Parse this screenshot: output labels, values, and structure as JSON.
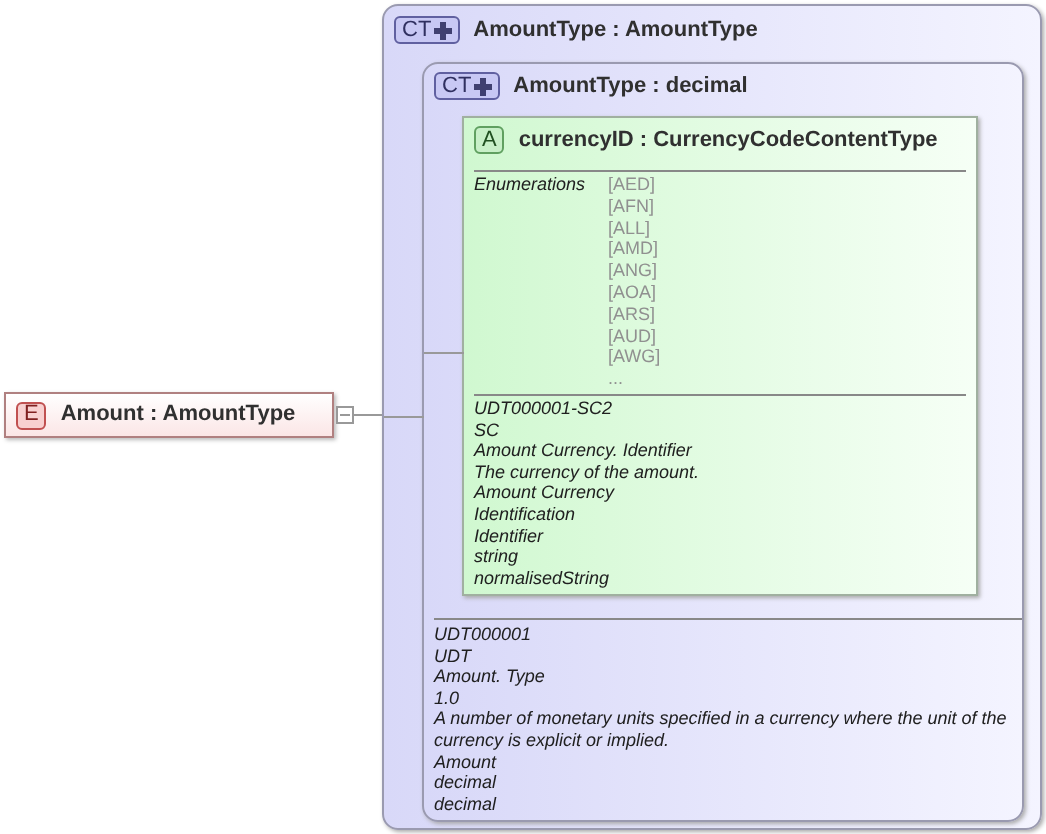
{
  "element": {
    "badge": "E",
    "name": "Amount",
    "type": ": AmountType"
  },
  "complex_type": {
    "badge": "CT",
    "name": "AmountType",
    "type": ": AmountType",
    "base_type": {
      "badge": "CT",
      "name": "AmountType",
      "type": ": decimal",
      "attribute": {
        "badge": "A",
        "name": "currencyID",
        "type": ": CurrencyCodeContentType",
        "enumerations_label": "Enumerations",
        "enumerations": [
          "[AED]",
          "[AFN]",
          "[ALL]",
          "[AMD]",
          "[ANG]",
          "[AOA]",
          "[ARS]",
          "[AUD]",
          "[AWG]",
          "..."
        ],
        "documentation": [
          "UDT000001-SC2",
          "SC",
          "Amount Currency. Identifier",
          "The currency of the amount.",
          "Amount Currency",
          "Identification",
          "Identifier",
          "string",
          "normalisedString"
        ]
      }
    },
    "documentation": [
      "UDT000001",
      "UDT",
      "Amount. Type",
      "1.0",
      "A number of monetary units specified in a currency where the unit of the currency is explicit or implied.",
      "Amount",
      "decimal",
      "decimal"
    ]
  }
}
